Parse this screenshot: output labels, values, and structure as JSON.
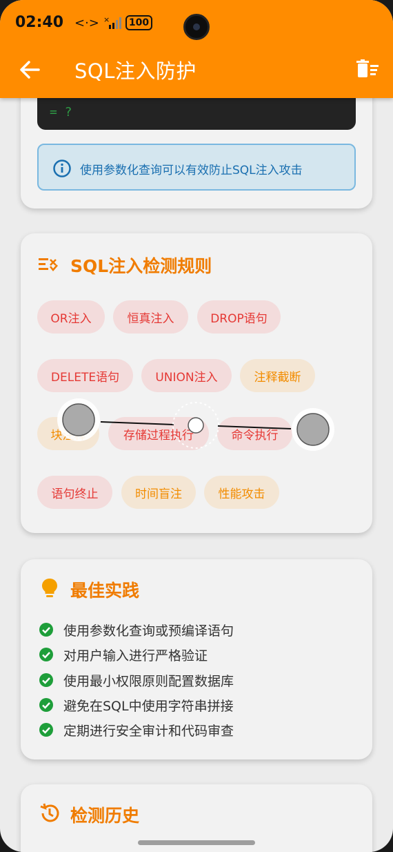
{
  "status_bar": {
    "time": "02:40",
    "network_glyph": "<·>",
    "battery": "100"
  },
  "app_bar": {
    "title": "SQL注入防护",
    "back_icon": "arrow-left-icon",
    "action_icon": "delete-sweep-icon",
    "color": "#ff8c00"
  },
  "top_card": {
    "code_snippet": "= ?",
    "info_text": "使用参数化查询可以有效防止SQL注入攻击"
  },
  "rules_card": {
    "title": "SQL注入检测规则",
    "chips": [
      {
        "label": "OR注入",
        "severity": "high"
      },
      {
        "label": "恒真注入",
        "severity": "high"
      },
      {
        "label": "DROP语句",
        "severity": "high"
      },
      {
        "label": "DELETE语句",
        "severity": "high"
      },
      {
        "label": "UNION注入",
        "severity": "high"
      },
      {
        "label": "注释截断",
        "severity": "medium"
      },
      {
        "label": "块注释",
        "severity": "medium"
      },
      {
        "label": "存储过程执行",
        "severity": "high"
      },
      {
        "label": "命令执行",
        "severity": "high"
      },
      {
        "label": "语句终止",
        "severity": "high"
      },
      {
        "label": "时间盲注",
        "severity": "medium"
      },
      {
        "label": "性能攻击",
        "severity": "medium"
      }
    ]
  },
  "best_practices_card": {
    "title": "最佳实践",
    "items": [
      "使用参数化查询或预编译语句",
      "对用户输入进行严格验证",
      "使用最小权限原则配置数据库",
      "避免在SQL中使用字符串拼接",
      "定期进行安全审计和代码审查"
    ]
  },
  "history_card": {
    "title": "检测历史"
  },
  "colors": {
    "accent": "#f07c00",
    "danger": "#e53935",
    "warning": "#f28c00",
    "success": "#1e9e3a",
    "info": "#1a6fb0"
  }
}
